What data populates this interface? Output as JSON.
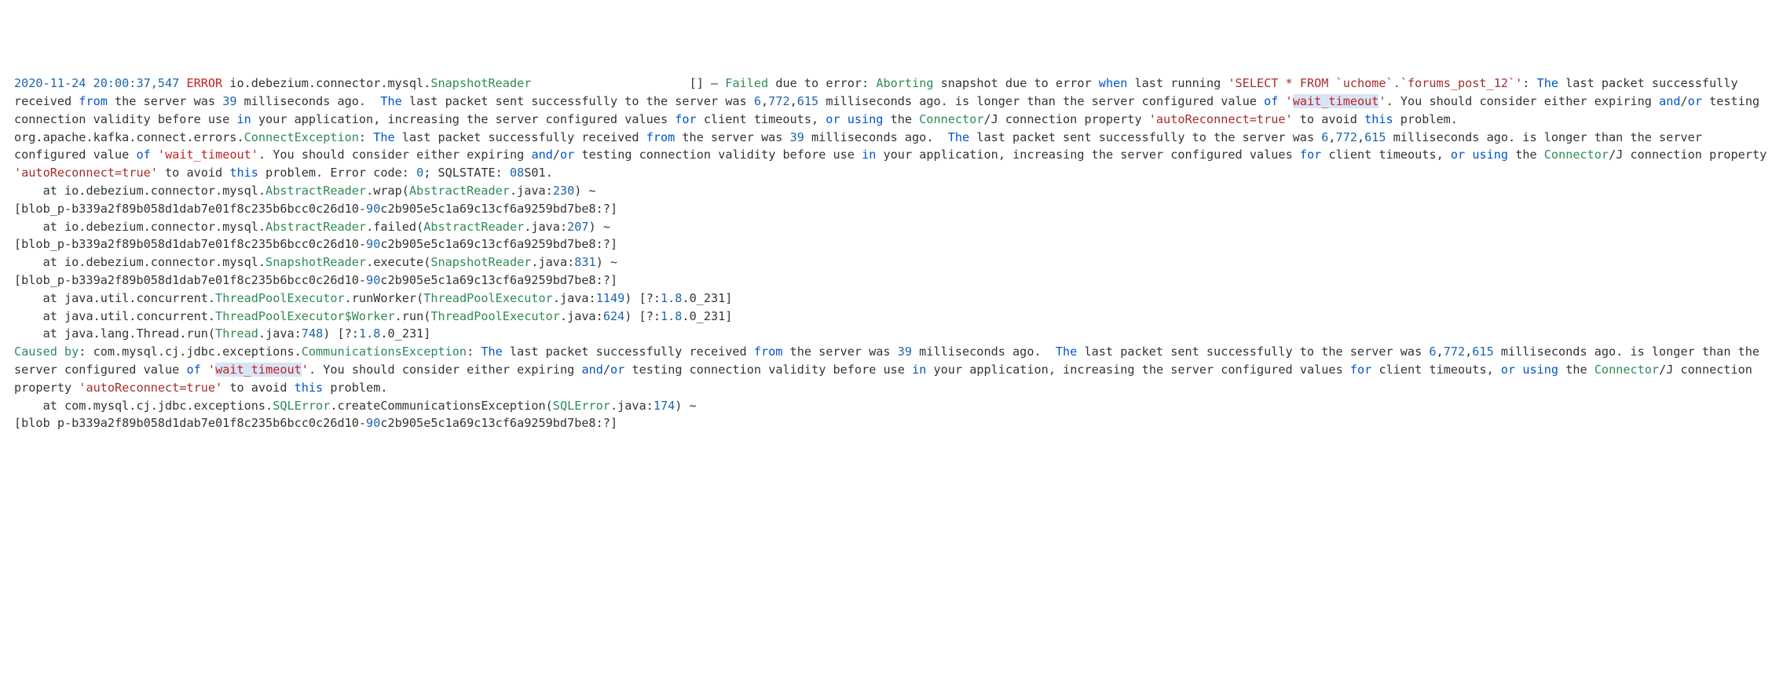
{
  "log": {
    "ts": "2020-11-24 20:00:37,547",
    "level": "ERROR",
    "logger": "io.debezium.connector.mysql.",
    "reader": "SnapshotReader",
    "sep": "[]",
    "failed": "Failed",
    "aborting": "Aborting",
    "when": "when",
    "msg1a": " due to error: ",
    "msg1b": " snapshot due to error ",
    "running": " last running ",
    "sql": "'SELECT * FROM `uchome`.`forums_post_12`'",
    "colon": ": ",
    "the": "The",
    "pkt1": " last packet successfully received ",
    "from": "from",
    "pkt1b": " the server was ",
    "ms1": "39",
    "pkt1c": " milliseconds ago.  ",
    "pkt2": " last packet sent successfully to the server was ",
    "ms2a": "6",
    "ms2b": "772",
    "ms2c": "615",
    "pkt2b": " milliseconds ago. is longer than the server configured value ",
    "of": "of",
    "wt_a": "'",
    "wt_b": "wait_timeout",
    "wt_c": "'",
    "dot": ".",
    "you": " You should consider either expiring ",
    "and": "and",
    "slash": "/",
    "or": "or",
    "test": " testing connection validity before use ",
    "in": "in",
    "app": " your application, increasing the server configured values ",
    "for": "for",
    "cli": " client timeouts, ",
    "using": "using",
    "conn": " the ",
    "conn2": "Connector",
    "J": "/J connection property ",
    "auto": "'autoReconnect=true'",
    "avoid": " to avoid ",
    "this": "this",
    "problem": " problem.",
    "excPkg": "org.apache.kafka.connect.errors.",
    "excCls": "ConnectException",
    "errcode": " Error code: ",
    "zero": "0",
    "sqlstate": "; SQLSTATE: ",
    "sqlv": "08",
    "sqlv2": "S01",
    "at": "    at ",
    "f1a": "io.debezium.connector.mysql.",
    "f1b": "AbstractReader",
    "f1c": ".wrap(",
    "f1d": "AbstractReader",
    "f1e": ".java:",
    "ln1": "230",
    "tilde": ") ~",
    "blob1": "[blob_p-b339a2f89b058d1dab7e01f8c235b6bcc0c26d10-",
    "blob2": "90",
    "blob3": "c2b905e5c1a69c13cf6a9259bd7be8:?]",
    "blob_sp": "[blob p-b339a2f89b058d1dab7e01f8c235b6bcc0c26d10-",
    "f2c": ".failed(",
    "ln2": "207",
    "f3b": "SnapshotReader",
    "f3c": ".execute(",
    "f3d": "SnapshotReader",
    "ln3": "831",
    "f4a": "java.util.concurrent.",
    "f4b": "ThreadPoolExecutor",
    "f4c": ".runWorker(",
    "f4d": "ThreadPoolExecutor",
    "ln4": "1149",
    "close4": ") [?:",
    "jv": "1.8",
    "jv2": ".0_231]",
    "f5b": "ThreadPoolExecutor$Worker",
    "f5c": ".run(",
    "ln5": "624",
    "f6a": "java.lang.Thread.run(",
    "f6b": "Thread",
    "ln6": "748",
    "caused": "Caused by",
    "cx1": ": com.mysql.cj.jdbc.exceptions.",
    "cx2": "CommunicationsException",
    "f7a": "com.mysql.cj.jdbc.exceptions.",
    "f7b": "SQLError",
    "f7c": ".createCommunicationsException(",
    "f7d": "SQLError",
    "ln7": "174"
  }
}
